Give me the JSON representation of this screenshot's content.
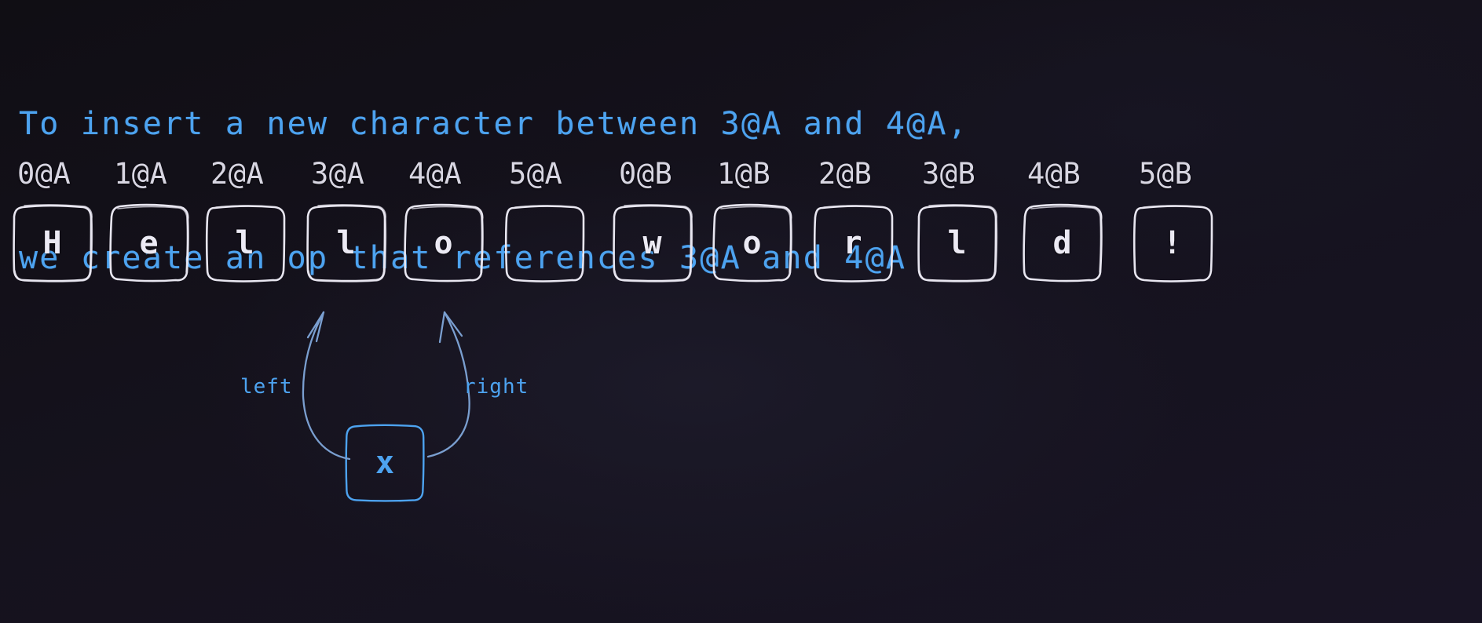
{
  "heading": {
    "line1": "To insert a new character between 3@A and 4@A,",
    "line2": "we create an op that references 3@A and 4@A",
    "color": "#4da3f0"
  },
  "colors": {
    "background": "#15121d",
    "cell_stroke": "#e8e6f0",
    "cell_text": "#eceaf4",
    "id_label": "#d8d6e2",
    "accent_blue": "#4da3f0"
  },
  "sequence": {
    "title": "Hello world!",
    "cells": [
      {
        "id": "0@A",
        "char": "H"
      },
      {
        "id": "1@A",
        "char": "e"
      },
      {
        "id": "2@A",
        "char": "l"
      },
      {
        "id": "3@A",
        "char": "l"
      },
      {
        "id": "4@A",
        "char": "o"
      },
      {
        "id": "5@A",
        "char": " "
      },
      {
        "id": "0@B",
        "char": "w"
      },
      {
        "id": "1@B",
        "char": "o"
      },
      {
        "id": "2@B",
        "char": "r"
      },
      {
        "id": "3@B",
        "char": "l"
      },
      {
        "id": "4@B",
        "char": "d"
      },
      {
        "id": "5@B",
        "char": "!"
      }
    ]
  },
  "operation": {
    "char": "x",
    "edges": [
      {
        "label": "left",
        "target_id": "3@A"
      },
      {
        "label": "right",
        "target_id": "4@A"
      }
    ]
  }
}
